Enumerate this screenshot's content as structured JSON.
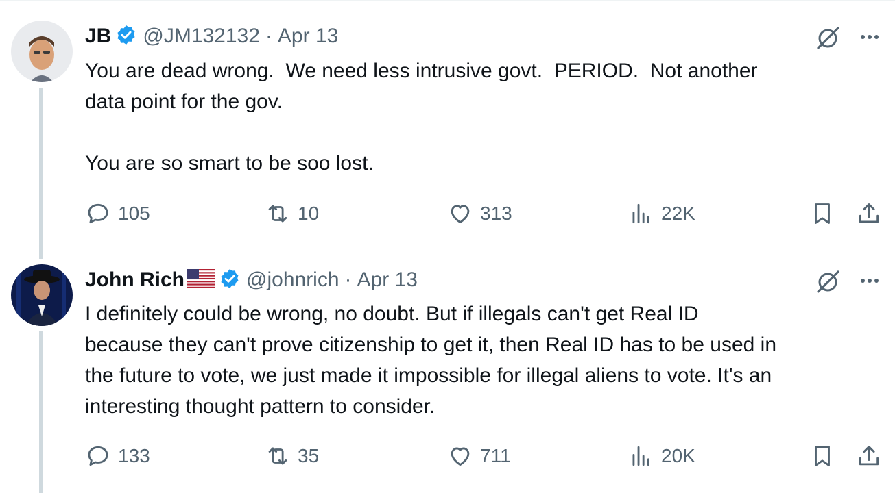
{
  "tweets": [
    {
      "name": "JB",
      "verified": true,
      "flag": "",
      "handle": "@JM132132",
      "separator": "·",
      "date": "Apr 13",
      "text": "You are dead wrong.  We need less intrusive govt.  PERIOD.  Not another\ndata point for the gov.\n\nYou are so smart to be soo lost.",
      "replies": "105",
      "reposts": "10",
      "likes": "313",
      "views": "22K"
    },
    {
      "name": "John Rich",
      "verified": true,
      "flag": "us-flag",
      "handle": "@johnrich",
      "separator": "·",
      "date": "Apr 13",
      "text": "I definitely could be wrong, no doubt. But if illegals can't get Real ID\nbecause they can't prove citizenship to get it, then Real ID has to be used in\nthe future to vote, we just made it impossible for illegal aliens to vote. It's an\ninteresting thought pattern to consider.",
      "replies": "133",
      "reposts": "35",
      "likes": "711",
      "views": "20K"
    }
  ],
  "colors": {
    "text": "#0f1419",
    "secondary": "#536471",
    "verified": "#1d9bf0",
    "thread_line": "#cfd9de"
  },
  "icons": [
    "reply-icon",
    "repost-icon",
    "like-icon",
    "views-icon",
    "bookmark-icon",
    "share-icon",
    "grok-icon",
    "more-icon",
    "verified-badge-icon"
  ]
}
